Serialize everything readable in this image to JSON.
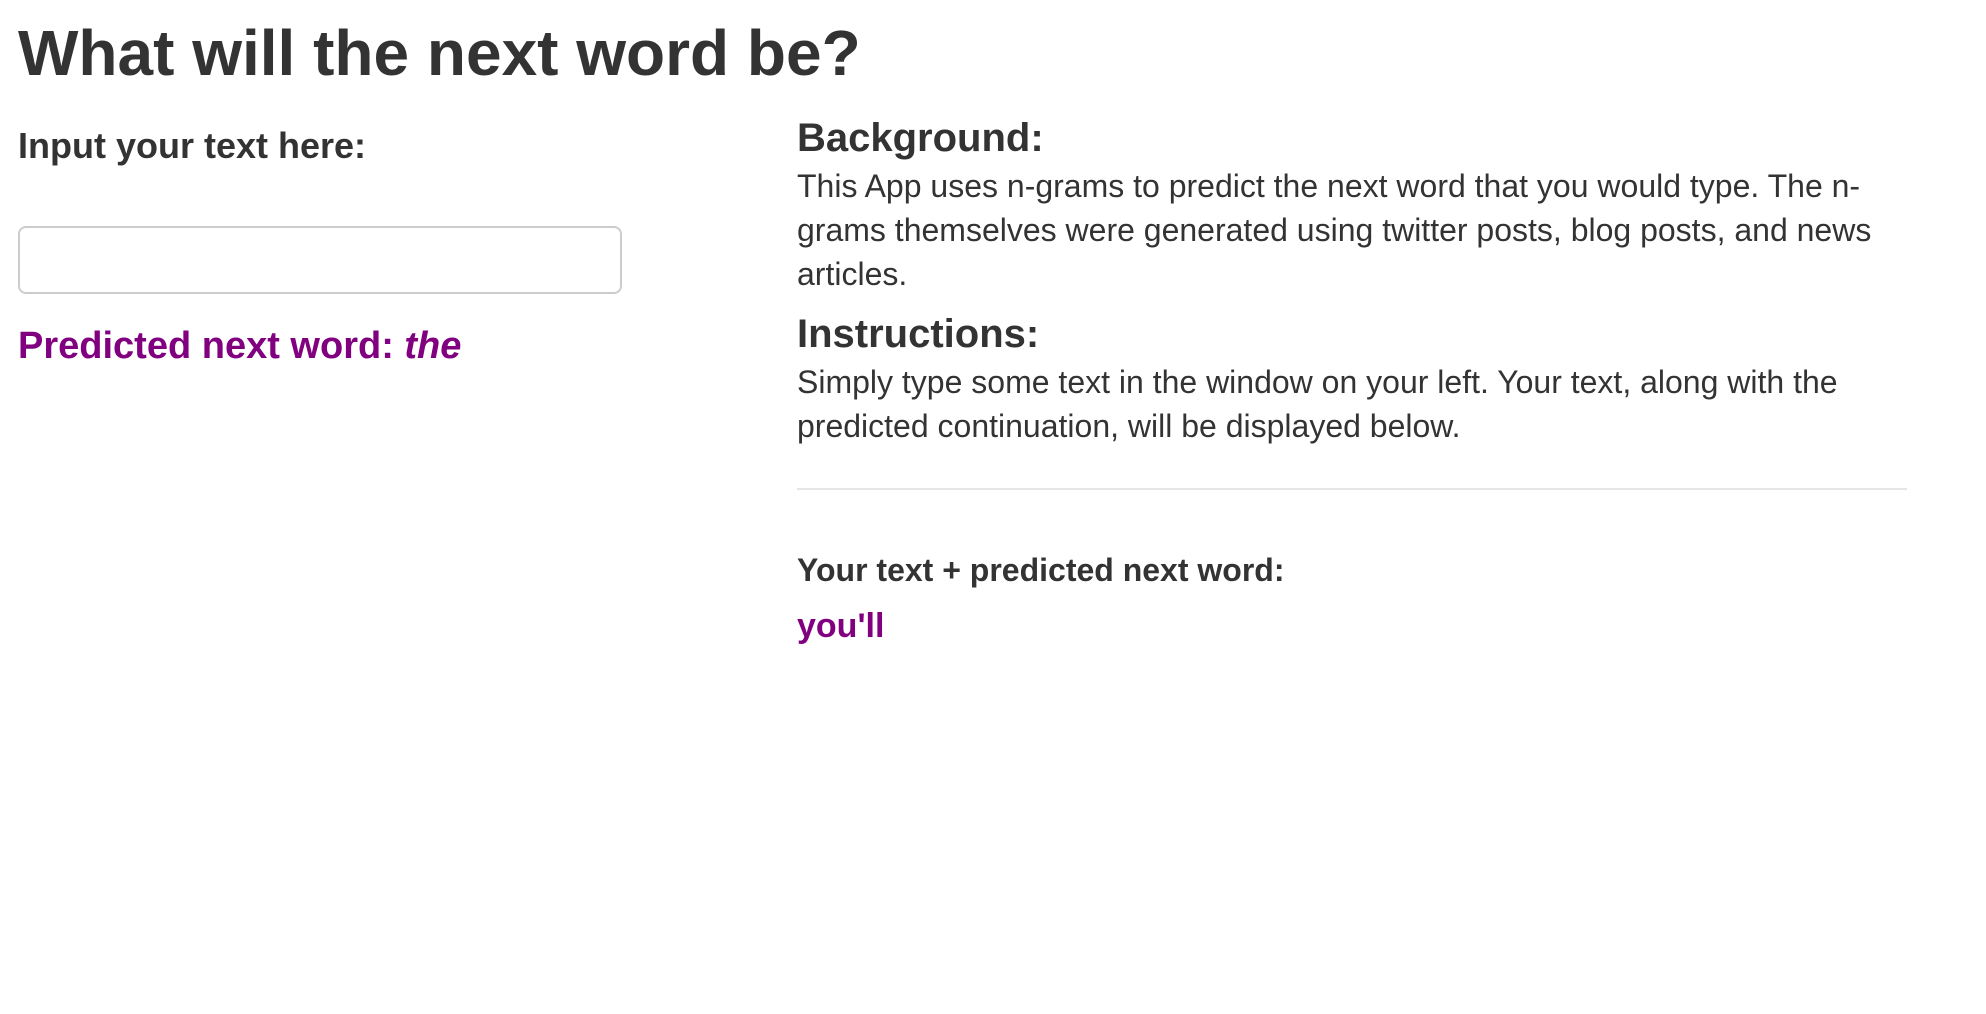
{
  "header": {
    "title": "What will the next word be?"
  },
  "input_panel": {
    "label": "Input your text here:",
    "input_value": "",
    "prediction_prefix": "Predicted next word: ",
    "predicted_word": "the"
  },
  "info_panel": {
    "background_heading": "Background:",
    "background_text": "This App uses n-grams to predict the next word that you would type. The n-grams themselves were generated using twitter posts, blog posts, and news articles.",
    "instructions_heading": "Instructions:",
    "instructions_text": "Simply type some text in the window on your left. Your text, along with the predicted continuation, will be displayed below.",
    "output_label": "Your text + predicted next word:",
    "output_text": "you'll"
  },
  "colors": {
    "text": "#333333",
    "accent_purple": "#800080",
    "input_border": "#cccccc",
    "divider": "#e5e5e5"
  }
}
